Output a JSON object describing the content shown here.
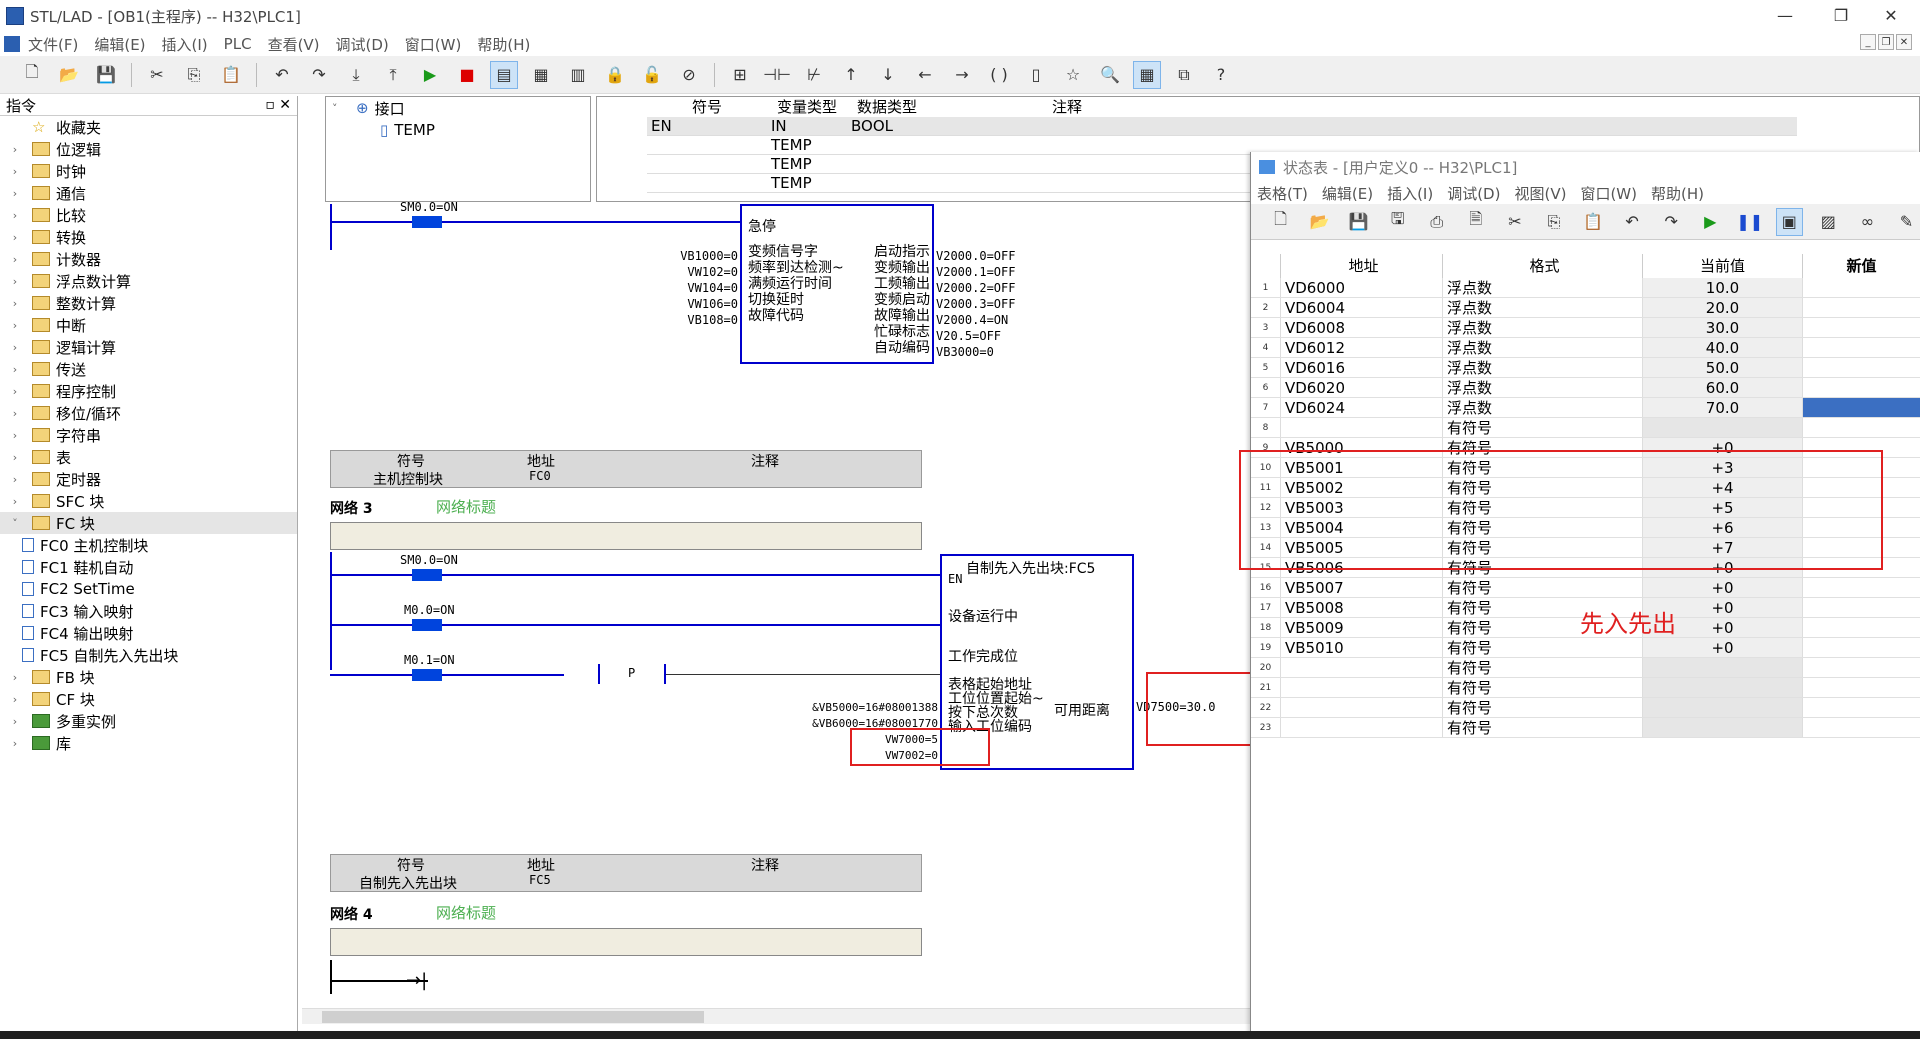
{
  "window": {
    "title": "STL/LAD - [OB1(主程序) -- H32\\PLC1]"
  },
  "menu": [
    "文件(F)",
    "编辑(E)",
    "插入(I)",
    "PLC",
    "查看(V)",
    "调试(D)",
    "窗口(W)",
    "帮助(H)"
  ],
  "toolbar": [
    "new-icon",
    "open-icon",
    "save-icon",
    "cut-icon",
    "copy-icon",
    "paste-icon",
    "undo-icon",
    "redo-icon",
    "download-icon",
    "upload-icon",
    "run-icon",
    "stop-icon",
    "program-status-icon",
    "table-status-icon",
    "force-icon",
    "lock-icon",
    "unlock-icon",
    "unforce-icon",
    "zoom-icon",
    "view-icon",
    "help-icon"
  ],
  "left_panel": {
    "title": "指令",
    "items": [
      {
        "label": "收藏夹",
        "icon": "star-icon"
      },
      {
        "label": "位逻辑"
      },
      {
        "label": "时钟"
      },
      {
        "label": "通信"
      },
      {
        "label": "比较"
      },
      {
        "label": "转换"
      },
      {
        "label": "计数器"
      },
      {
        "label": "浮点数计算"
      },
      {
        "label": "整数计算"
      },
      {
        "label": "中断"
      },
      {
        "label": "逻辑计算"
      },
      {
        "label": "传送"
      },
      {
        "label": "程序控制"
      },
      {
        "label": "移位/循环"
      },
      {
        "label": "字符串"
      },
      {
        "label": "表"
      },
      {
        "label": "定时器"
      },
      {
        "label": "SFC 块"
      },
      {
        "label": "FC 块",
        "expanded": true
      },
      {
        "label": "FC0  主机控制块",
        "child": true
      },
      {
        "label": "FC1  鞋机自动",
        "child": true
      },
      {
        "label": "FC2  SetTime",
        "child": true
      },
      {
        "label": "FC3  输入映射",
        "child": true
      },
      {
        "label": "FC4  输出映射",
        "child": true
      },
      {
        "label": "FC5  自制先入先出块",
        "child": true
      },
      {
        "label": "FB 块"
      },
      {
        "label": "CF 块"
      },
      {
        "label": "多重实例"
      },
      {
        "label": "库"
      }
    ]
  },
  "interface": {
    "root": "接口",
    "child": "TEMP"
  },
  "symbol_table": {
    "headers": [
      "符号",
      "变量类型",
      "数据类型",
      "注释"
    ],
    "rows": [
      {
        "sym": "EN",
        "vartype": "IN",
        "dtype": "BOOL"
      },
      {
        "sym": "",
        "vartype": "TEMP",
        "dtype": ""
      },
      {
        "sym": "",
        "vartype": "TEMP",
        "dtype": ""
      },
      {
        "sym": "",
        "vartype": "TEMP",
        "dtype": ""
      }
    ]
  },
  "ladder": {
    "net2": {
      "contact": "SM0.0=ON",
      "block_title": "急停",
      "inputs": [
        "VB1000=0",
        "VW102=0",
        "VW104=0",
        "VW106=0",
        "VB108=0"
      ],
      "in_labels": [
        "变频信号字",
        "频率到达检测~",
        "满频运行时间",
        "切换延时",
        "故障代码"
      ],
      "out_labels": [
        "启动指示",
        "变频输出",
        "工频输出",
        "变频启动",
        "故障输出",
        "忙碌标志",
        "自动编码"
      ],
      "outputs": [
        "V2000.0=OFF",
        "V2000.1=OFF",
        "V2000.2=OFF",
        "V2000.3=OFF",
        "V2000.4=ON",
        "V20.5=OFF",
        "VB3000=0"
      ],
      "info": {
        "h_sym": "符号",
        "h_addr": "地址",
        "h_cmt": "注释",
        "sym": "主机控制块",
        "addr": "FC0"
      }
    },
    "net3": {
      "label": "网络 3",
      "title": "网络标题",
      "c1": "SM0.0=ON",
      "c2": "M0.0=ON",
      "c3": "M0.1=ON",
      "p": "P",
      "block_title": "自制先入先出块:FC5",
      "en": "EN",
      "pins": [
        "设备运行中",
        "工作完成位",
        "表格起始地址",
        "工位位置起始~",
        "按下总次数",
        "输入工位编码"
      ],
      "right_pin": "可用距离",
      "in_vals": [
        "&VB5000=16#08001388",
        "&VB6000=16#08001770",
        "VW7000=5",
        "VW7002=0"
      ],
      "out_val": "VD7500=30.0",
      "info": {
        "h_sym": "符号",
        "h_addr": "地址",
        "h_cmt": "注释",
        "sym": "自制先入先出块",
        "addr": "FC5"
      }
    },
    "net4": {
      "label": "网络 4",
      "title": "网络标题"
    }
  },
  "status_window": {
    "title": "状态表 - [用户定义0 -- H32\\PLC1]",
    "menu": [
      "表格(T)",
      "编辑(E)",
      "插入(I)",
      "调试(D)",
      "视图(V)",
      "窗口(W)",
      "帮助(H)"
    ],
    "headers": [
      "地址",
      "格式",
      "当前值",
      "新值"
    ],
    "rows": [
      {
        "n": "1",
        "addr": "VD6000",
        "fmt": "浮点数",
        "val": "10.0"
      },
      {
        "n": "2",
        "addr": "VD6004",
        "fmt": "浮点数",
        "val": "20.0"
      },
      {
        "n": "3",
        "addr": "VD6008",
        "fmt": "浮点数",
        "val": "30.0"
      },
      {
        "n": "4",
        "addr": "VD6012",
        "fmt": "浮点数",
        "val": "40.0"
      },
      {
        "n": "5",
        "addr": "VD6016",
        "fmt": "浮点数",
        "val": "50.0"
      },
      {
        "n": "6",
        "addr": "VD6020",
        "fmt": "浮点数",
        "val": "60.0"
      },
      {
        "n": "7",
        "addr": "VD6024",
        "fmt": "浮点数",
        "val": "70.0"
      },
      {
        "n": "8",
        "addr": "",
        "fmt": "有符号",
        "val": ""
      },
      {
        "n": "9",
        "addr": "VB5000",
        "fmt": "有符号",
        "val": "+0"
      },
      {
        "n": "10",
        "addr": "VB5001",
        "fmt": "有符号",
        "val": "+3"
      },
      {
        "n": "11",
        "addr": "VB5002",
        "fmt": "有符号",
        "val": "+4"
      },
      {
        "n": "12",
        "addr": "VB5003",
        "fmt": "有符号",
        "val": "+5"
      },
      {
        "n": "13",
        "addr": "VB5004",
        "fmt": "有符号",
        "val": "+6"
      },
      {
        "n": "14",
        "addr": "VB5005",
        "fmt": "有符号",
        "val": "+7"
      },
      {
        "n": "15",
        "addr": "VB5006",
        "fmt": "有符号",
        "val": "+0"
      },
      {
        "n": "16",
        "addr": "VB5007",
        "fmt": "有符号",
        "val": "+0"
      },
      {
        "n": "17",
        "addr": "VB5008",
        "fmt": "有符号",
        "val": "+0"
      },
      {
        "n": "18",
        "addr": "VB5009",
        "fmt": "有符号",
        "val": "+0"
      },
      {
        "n": "19",
        "addr": "VB5010",
        "fmt": "有符号",
        "val": "+0"
      },
      {
        "n": "20",
        "addr": "",
        "fmt": "有符号",
        "val": ""
      },
      {
        "n": "21",
        "addr": "",
        "fmt": "有符号",
        "val": ""
      },
      {
        "n": "22",
        "addr": "",
        "fmt": "有符号",
        "val": ""
      },
      {
        "n": "23",
        "addr": "",
        "fmt": "有符号",
        "val": ""
      }
    ]
  },
  "annotation": "先入先出",
  "colors": {
    "accent": "#0000cc",
    "highlight": "#e02020",
    "selected_cell": "#3b6fc2"
  }
}
